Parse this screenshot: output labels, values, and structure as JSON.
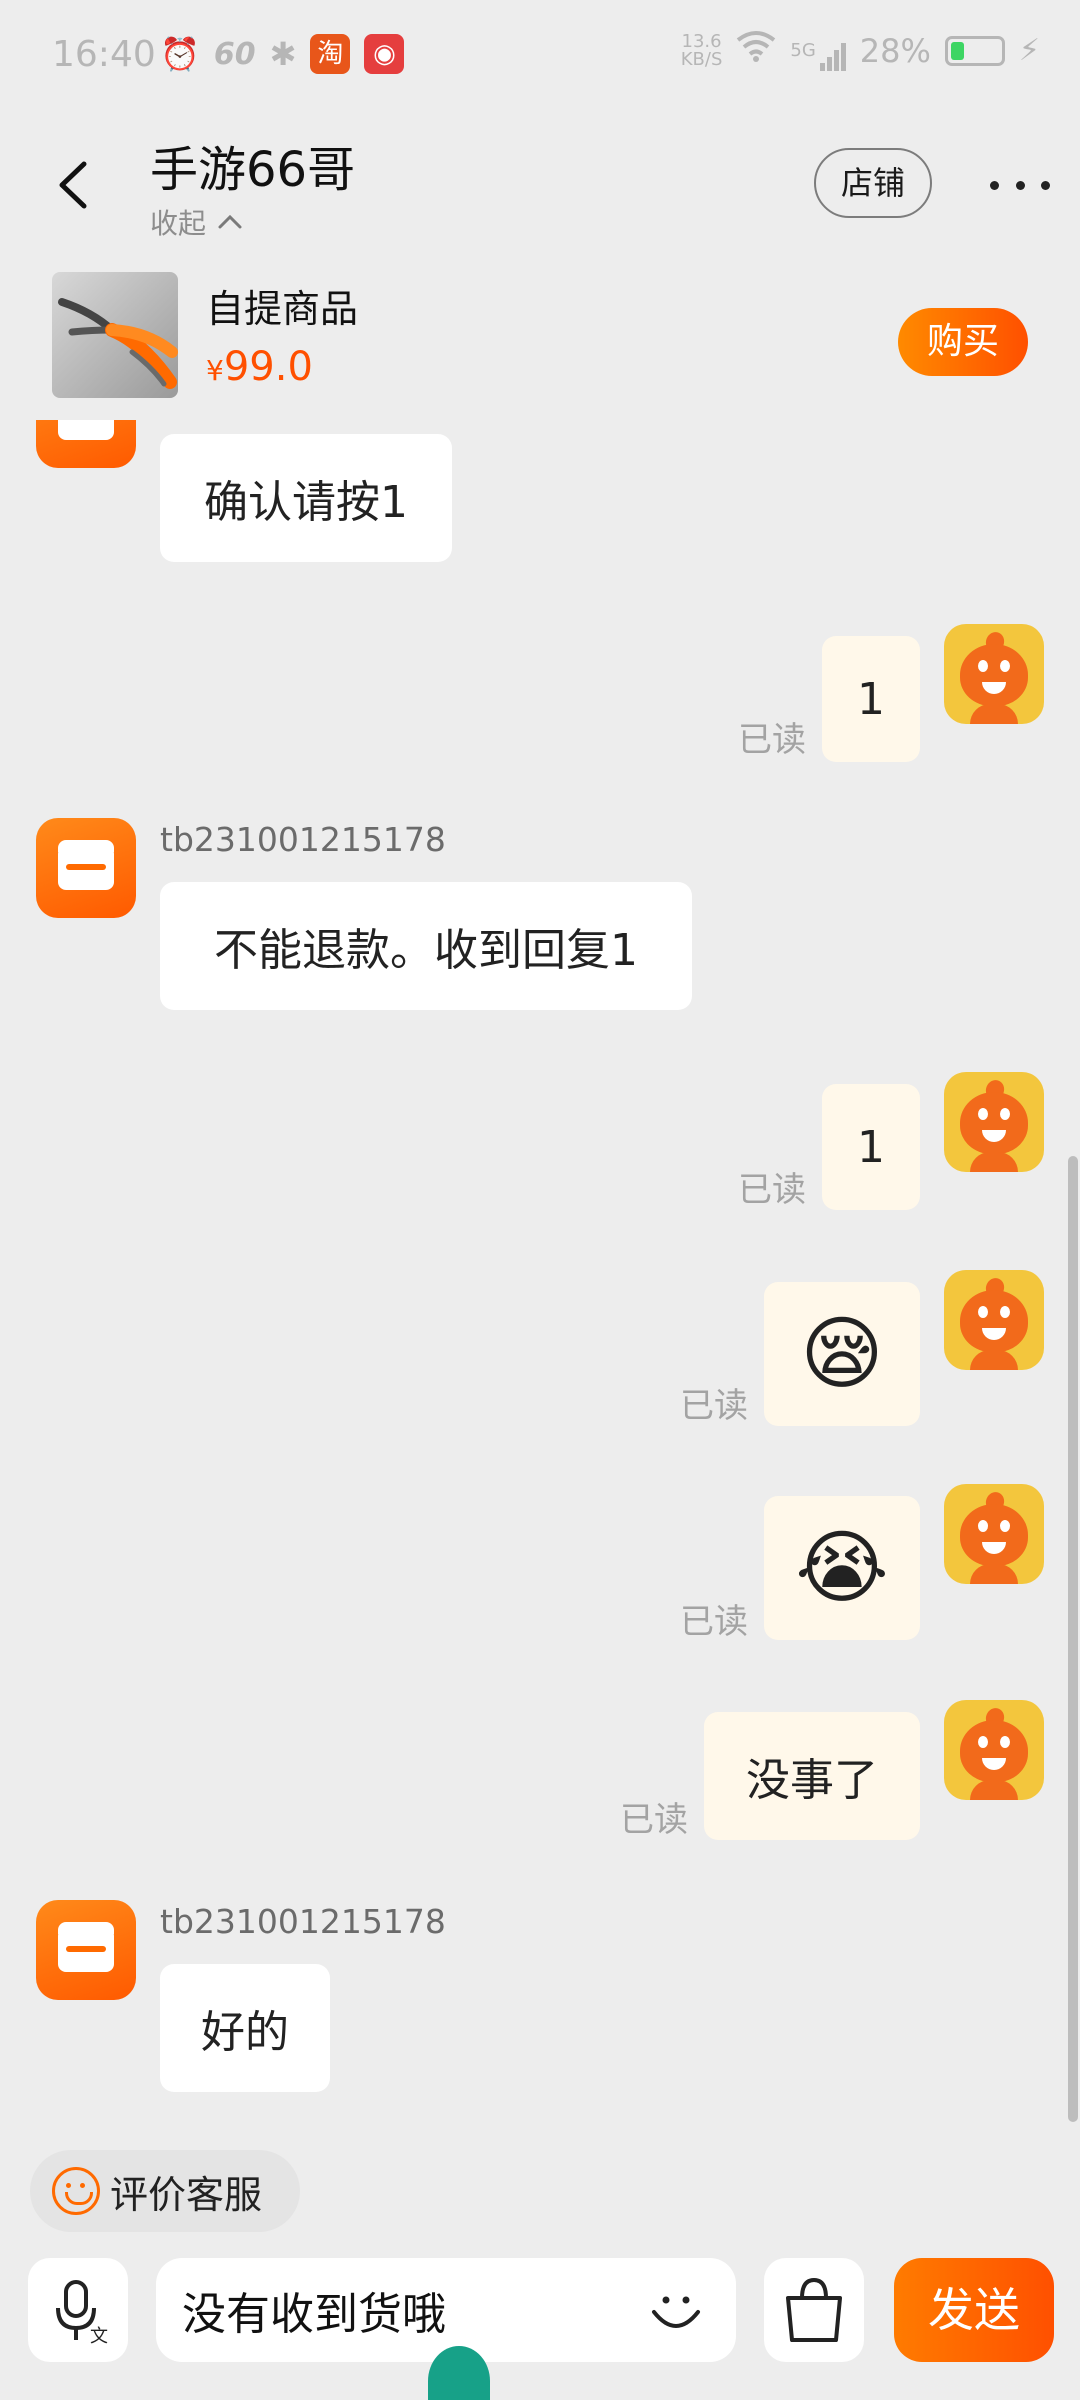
{
  "status_bar": {
    "time": "16:40",
    "refresh_rate": "60",
    "net_speed_value": "13.6",
    "net_speed_unit": "KB/S",
    "network": "5G",
    "battery": "28%",
    "battery_level": 0.28
  },
  "header": {
    "title": "手游66哥",
    "collapse_label": "收起",
    "shop_label": "店铺"
  },
  "product": {
    "name": "自提商品",
    "currency": "¥",
    "price": "99.0",
    "buy_label": "购买"
  },
  "messages": [
    {
      "from": "shop",
      "text": "确认请按1"
    },
    {
      "from": "me",
      "text": "1",
      "status": "已读"
    },
    {
      "from": "shop",
      "sender": "tb231001215178",
      "text": "不能退款。收到回复1"
    },
    {
      "from": "me",
      "text": "1",
      "status": "已读"
    },
    {
      "from": "me",
      "emoji": "😪",
      "status": "已读"
    },
    {
      "from": "me",
      "emoji": "😭",
      "status": "已读"
    },
    {
      "from": "me",
      "text": "没事了",
      "status": "已读"
    },
    {
      "from": "shop",
      "sender": "tb231001215178",
      "text": "好的"
    }
  ],
  "rate_service": {
    "label": "评价客服"
  },
  "composer": {
    "input_value": "没有收到货哦",
    "send_label": "发送"
  },
  "colors": {
    "accent": "#ff5000",
    "background": "#ededed",
    "my_bubble": "#fff8ea"
  }
}
